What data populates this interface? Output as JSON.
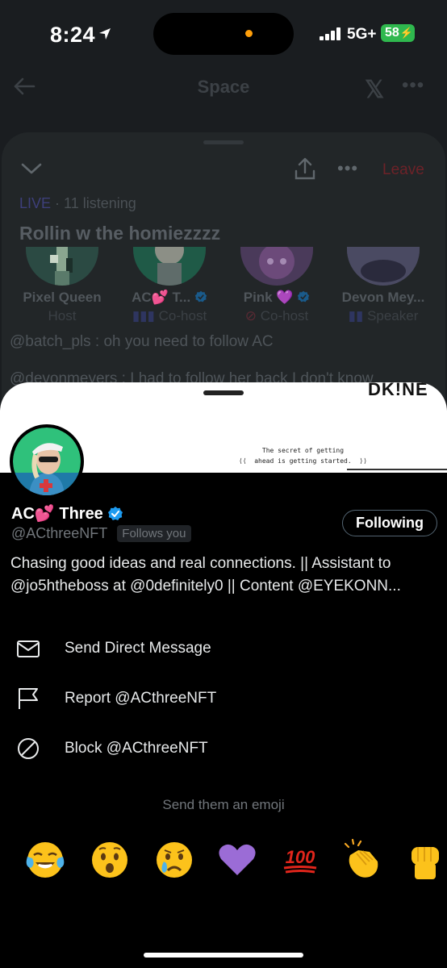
{
  "status_bar": {
    "time": "8:24",
    "network": "5G+",
    "battery": "58"
  },
  "space": {
    "header_title": "Space",
    "leave_label": "Leave",
    "live_label": "LIVE",
    "listening_text": " · 11 listening",
    "title": "Rollin w the homiezzzz",
    "speakers": [
      {
        "name": "Pixel Queen",
        "role": "Host"
      },
      {
        "name": "AC💕 T...",
        "role": "Co-host"
      },
      {
        "name": "Pink 💜",
        "role": "Co-host"
      },
      {
        "name": "Devon Mey...",
        "role": "Speaker"
      }
    ],
    "chat": [
      "@batch_pls :  oh you need to follow AC",
      "@devonmeyers :  I had to follow her back I don't know"
    ]
  },
  "profile": {
    "banner_quote": "The secret of getting ahead is getting started.",
    "banner_brand": "DK!NE",
    "display_name": "AC💕 Three",
    "handle": "@ACthreeNFT",
    "follows_you": "Follows you",
    "following_label": "Following",
    "bio": "Chasing good ideas and real connections. || Assistant to @jo5htheboss at @0definitely0 || Content @EYEKONN..."
  },
  "actions": [
    {
      "icon": "envelope-icon",
      "label": "Send Direct Message"
    },
    {
      "icon": "flag-icon",
      "label": "Report @ACthreeNFT"
    },
    {
      "icon": "block-icon",
      "label": "Block @ACthreeNFT"
    }
  ],
  "emoji_prompt": "Send them an emoji",
  "emojis": [
    "face-with-tears-of-joy",
    "astonished-face",
    "crying-face",
    "purple-heart",
    "hundred-points",
    "clapping-hands",
    "raised-fist"
  ],
  "colors": {
    "accent": "#1d9bf0",
    "live": "#3d3f7a",
    "leave": "#6d2228",
    "battery": "#2fb84e"
  }
}
